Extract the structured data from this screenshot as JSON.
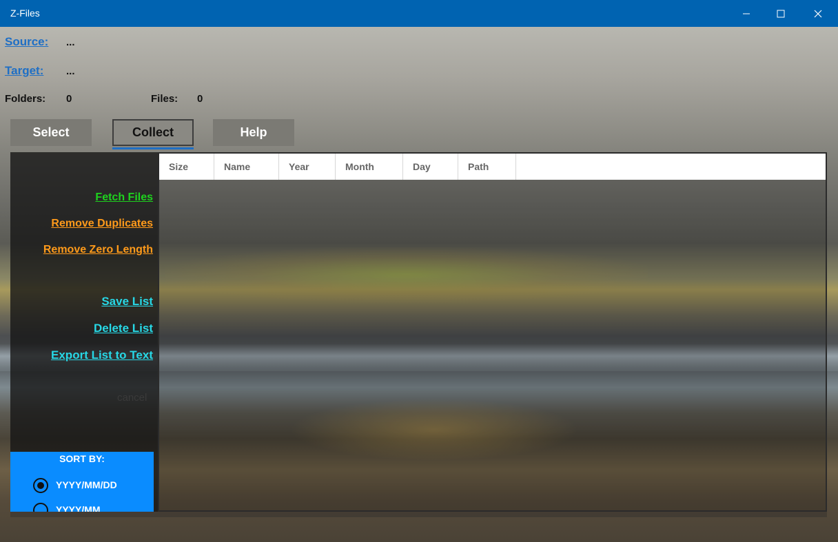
{
  "window": {
    "title": "Z-Files"
  },
  "header": {
    "source_label": "Source:",
    "source_value": "...",
    "target_label": "Target:",
    "target_value": "...",
    "folders_label": "Folders:",
    "folders_value": "0",
    "files_label": "Files:",
    "files_value": "0"
  },
  "buttons": {
    "select": "Select",
    "collect": "Collect",
    "help": "Help"
  },
  "actions": {
    "fetch_files": "Fetch Files",
    "remove_duplicates": "Remove Duplicates",
    "remove_zero_length": "Remove Zero Length",
    "save_list": "Save List",
    "delete_list": "Delete List",
    "export_list": "Export List to Text",
    "cancel": "cancel"
  },
  "sort": {
    "title": "SORT BY:",
    "options": [
      "YYYY/MM/DD",
      "YYYY/MM"
    ],
    "selected": "YYYY/MM/DD"
  },
  "grid": {
    "columns": [
      "Size",
      "Name",
      "Year",
      "Month",
      "Day",
      "Path"
    ]
  },
  "colors": {
    "titlebar": "#0063b1",
    "link_blue": "#1f6fc5",
    "fetch_green": "#1ed21e",
    "remove_orange": "#ff9a1a",
    "list_cyan": "#27d8e6",
    "sort_blue": "#0a8cff"
  }
}
